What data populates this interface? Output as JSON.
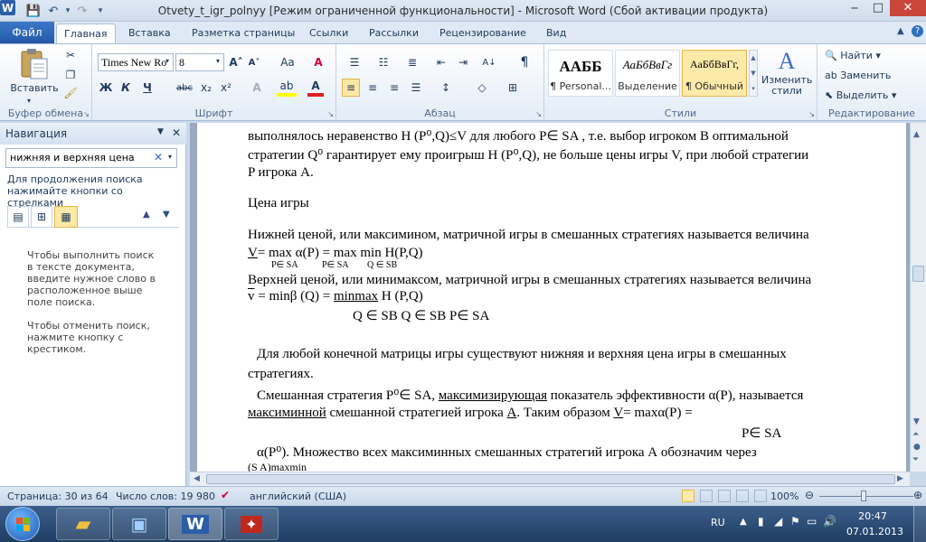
{
  "window": {
    "title": "Otvety_t_igr_polnyy [Режим ограниченной функциональности]  -  Microsoft Word (Сбой активации продукта)"
  },
  "quick_access": {
    "save": "💾",
    "undo": "↶",
    "redo": "↷",
    "customize": "▾"
  },
  "window_controls": {
    "minimize": "─",
    "maximize": "□",
    "close": "✕"
  },
  "tabs": [
    "Файл",
    "Главная",
    "Вставка",
    "Разметка страницы",
    "Ссылки",
    "Рассылки",
    "Рецензирование",
    "Вид"
  ],
  "ribbon": {
    "clipboard": {
      "label": "Буфер обмена",
      "paste": "Вставить"
    },
    "font": {
      "label": "Шрифт",
      "font_name": "Times New Ro",
      "font_size": "8",
      "grow": "A˄",
      "shrink": "A˅",
      "case": "Aa",
      "clear": "A",
      "bold": "Ж",
      "italic": "К",
      "underline": "Ч",
      "strike": "abc",
      "sub": "x₂",
      "sup": "x²",
      "effects": "A",
      "highlight": "ab",
      "color": "A"
    },
    "paragraph": {
      "label": "Абзац"
    },
    "styles": {
      "label": "Стили",
      "items": [
        {
          "sample": "ААББ",
          "name": "¶ Personal..."
        },
        {
          "sample": "АаБбВвГг",
          "name": "Выделение"
        },
        {
          "sample": "АаБбВвГг,",
          "name": "¶ Обычный"
        }
      ],
      "change": "Изменить стили"
    },
    "editing": {
      "label": "Редактирование",
      "find": "Найти",
      "replace": "Заменить",
      "select": "Выделить"
    }
  },
  "nav": {
    "title": "Навигация",
    "search_value": "нижняя и верхняя цена",
    "hint": "Для продолжения поиска нажимайте кнопки со стрелками",
    "help1": "Чтобы выполнить поиск в тексте документа, введите нужное слово в расположенное выше поле поиска.",
    "help2": "Чтобы отменить поиск, нажмите кнопку с крестиком."
  },
  "document": {
    "l1": "выполнялось неравенство H (P⁰,Q)≤V  для любого P∈ SA  , т.е. выбор игроком В оптимальной",
    "l2": "стратегии  Q⁰ гарантирует ему проигрыш H (P⁰,Q), не больше цены игры V, при любой стратегии",
    "l3": "P игрока А.",
    "l4": "Цена игры",
    "l5": "Нижней ценой, или максимином, матричной игры в смешанных стратегиях называется величина",
    "l6a": "V",
    "l6b": "= max α(P) = max  min  H(P,Q)",
    "s6a": "P∈ SA",
    "s6b": "P∈ SA",
    "s6c": "Q ∈ SB",
    "l7": "Верхней ценой, или минимаксом, матричной игры в смешанных стратегиях называется величина",
    "l8a": "v",
    "l8b": " = minβ (Q) = ",
    "l8c": "minmax",
    "l8d": "  H (P,Q)",
    "l9": "Q ∈ SB            Q ∈ SB   P∈ SA",
    "l10": "Для любой конечной матрицы игры существуют нижняя и верхняя цена  игры в смешанных",
    "l11": "стратегиях.",
    "l12a": "Смешанная стратегия P⁰∈ SA, ",
    "l12b": "максимизирующая",
    "l12c": " показатель эффективности α(P), называется",
    "l13a": "максиминной",
    "l13b": " смешанной стратегией игрока ",
    "l13c": "А",
    "l13d": ". Таким образом ",
    "l13e": "V",
    "l13f": "= maxα(P) =",
    "l14": "P∈ SA",
    "l15": "α(P⁰). Множество всех максиминных смешанных стратегий игрока А обозначим через",
    "l16": "(S A)maxmin"
  },
  "status": {
    "page": "Страница: 30 из 64",
    "words": "Число слов: 19 980",
    "language": "английский (США)",
    "zoom": "100%"
  },
  "taskbar": {
    "lang": "RU",
    "time": "20:47",
    "date": "07.01.2013"
  }
}
